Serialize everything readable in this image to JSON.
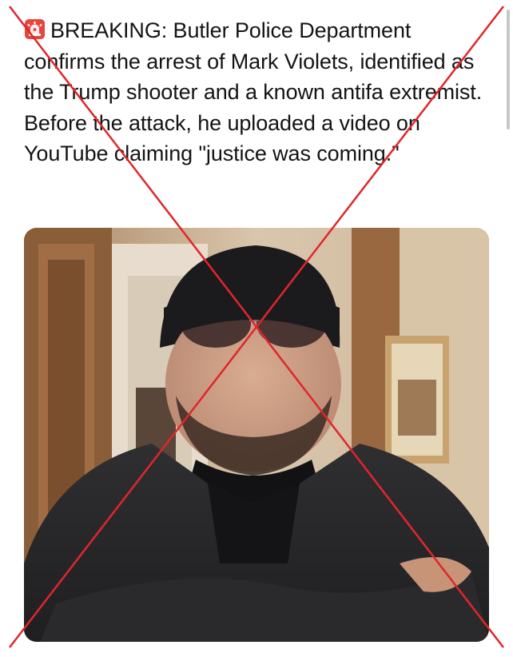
{
  "post": {
    "siren_icon": "rotating-light-icon",
    "text": "BREAKING: Butler Police Department confirms the arrest of Mark Violets, identified as the Trump shooter and a known antifa extremist. Before the attack, he uploaded a video on YouTube claiming \"justice was coming.\"",
    "media": {
      "type": "photo"
    }
  },
  "overlay": {
    "type": "red-x-cross-out",
    "color": "#e0262b"
  }
}
